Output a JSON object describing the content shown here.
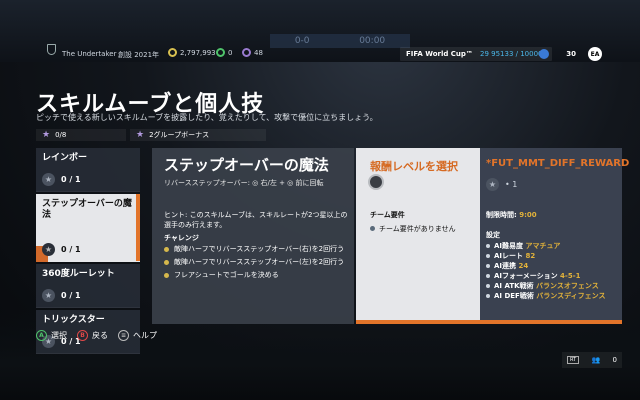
{
  "background": {
    "scoreboard": "0-0",
    "time": "00:00"
  },
  "topbar": {
    "club_name": "The Undertaker",
    "club_founded": "創設 2021年",
    "coins": "2,797,993",
    "points": "0",
    "sp": "48",
    "season_title": "FIFA World Cup™",
    "season_progress": "29  95133 / 100000",
    "level": "30",
    "ea_logo": "EA"
  },
  "page": {
    "title": "スキルムーブと個人技",
    "subtitle": "ピッチで使える新しいスキルムーブを披露したり、覚えたりして、攻撃で優位に立ちましょう。"
  },
  "counters": {
    "progress": "0/8",
    "bonus": "2グループボーナス"
  },
  "list": [
    {
      "label": "レインボー",
      "progress": "0 / 1"
    },
    {
      "label": "ステップオーバーの魔法",
      "progress": "0 / 1"
    },
    {
      "label": "360度ルーレット",
      "progress": "0 / 1"
    },
    {
      "label": "トリックスター",
      "progress": "0 / 1"
    }
  ],
  "detail": {
    "title": "ステップオーバーの魔法",
    "input": "リバースステップオーバー: ◎ 右/左 + ◎ 前に回転",
    "hint": "ヒント: このスキルムーブは、スキルレートが2つ星以上の選手のみ行えます。",
    "challenge_label": "チャレンジ",
    "challenges": [
      "敵陣ハーフでリバースステップオーバー(右)を2回行う",
      "敵陣ハーフでリバースステップオーバー(左)を2回行う",
      "フレアシュートでゴールを決める"
    ]
  },
  "reward": {
    "title": "報酬レベルを選択",
    "team_req_label": "チーム要件",
    "team_req_value": "チーム要件がありません",
    "difficulty_title": "*FUT_MMT_DIFF_REWARD",
    "difficulty_stars": "• 1",
    "time_limit_label": "制限時間:",
    "time_limit_value": "9:00",
    "settings_label": "設定",
    "settings": [
      {
        "k": "AI難易度",
        "v": "アマチュア"
      },
      {
        "k": "AIレート",
        "v": "82"
      },
      {
        "k": "AI連携",
        "v": "24"
      },
      {
        "k": "AIフォーメーション",
        "v": "4-5-1"
      },
      {
        "k": "AI ATK戦術",
        "v": "バランスオフェンス"
      },
      {
        "k": "AI DEF戦術",
        "v": "バランスディフェンス"
      }
    ]
  },
  "controls": {
    "select": "選択",
    "back": "戻る",
    "help": "ヘルプ",
    "a": "A",
    "b": "B",
    "v": "≡"
  },
  "corner": {
    "rt": "RT",
    "count": "0"
  },
  "colors": {
    "accent": "#e2742a",
    "gold": "#e2b23a"
  }
}
